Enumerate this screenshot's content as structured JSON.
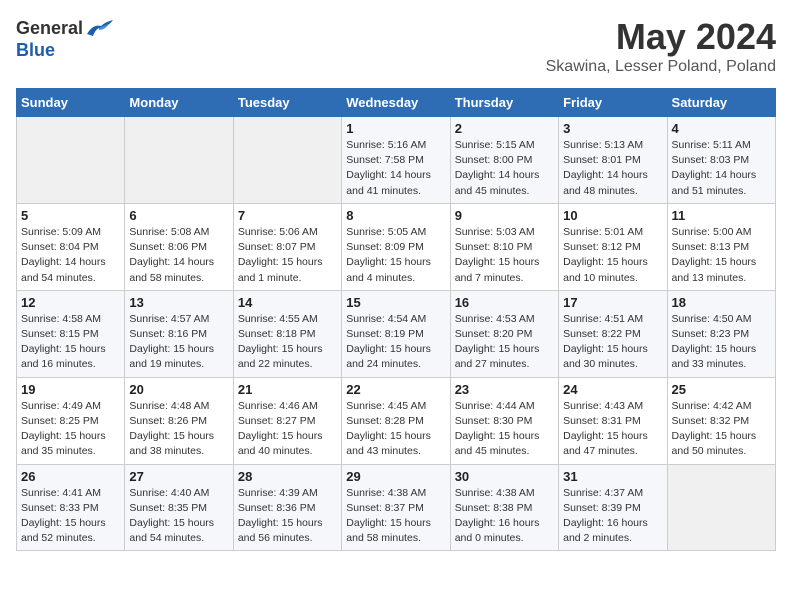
{
  "header": {
    "logo_general": "General",
    "logo_blue": "Blue",
    "month_title": "May 2024",
    "location": "Skawina, Lesser Poland, Poland"
  },
  "days_of_week": [
    "Sunday",
    "Monday",
    "Tuesday",
    "Wednesday",
    "Thursday",
    "Friday",
    "Saturday"
  ],
  "weeks": [
    [
      {
        "day": "",
        "info": ""
      },
      {
        "day": "",
        "info": ""
      },
      {
        "day": "",
        "info": ""
      },
      {
        "day": "1",
        "info": "Sunrise: 5:16 AM\nSunset: 7:58 PM\nDaylight: 14 hours\nand 41 minutes."
      },
      {
        "day": "2",
        "info": "Sunrise: 5:15 AM\nSunset: 8:00 PM\nDaylight: 14 hours\nand 45 minutes."
      },
      {
        "day": "3",
        "info": "Sunrise: 5:13 AM\nSunset: 8:01 PM\nDaylight: 14 hours\nand 48 minutes."
      },
      {
        "day": "4",
        "info": "Sunrise: 5:11 AM\nSunset: 8:03 PM\nDaylight: 14 hours\nand 51 minutes."
      }
    ],
    [
      {
        "day": "5",
        "info": "Sunrise: 5:09 AM\nSunset: 8:04 PM\nDaylight: 14 hours\nand 54 minutes."
      },
      {
        "day": "6",
        "info": "Sunrise: 5:08 AM\nSunset: 8:06 PM\nDaylight: 14 hours\nand 58 minutes."
      },
      {
        "day": "7",
        "info": "Sunrise: 5:06 AM\nSunset: 8:07 PM\nDaylight: 15 hours\nand 1 minute."
      },
      {
        "day": "8",
        "info": "Sunrise: 5:05 AM\nSunset: 8:09 PM\nDaylight: 15 hours\nand 4 minutes."
      },
      {
        "day": "9",
        "info": "Sunrise: 5:03 AM\nSunset: 8:10 PM\nDaylight: 15 hours\nand 7 minutes."
      },
      {
        "day": "10",
        "info": "Sunrise: 5:01 AM\nSunset: 8:12 PM\nDaylight: 15 hours\nand 10 minutes."
      },
      {
        "day": "11",
        "info": "Sunrise: 5:00 AM\nSunset: 8:13 PM\nDaylight: 15 hours\nand 13 minutes."
      }
    ],
    [
      {
        "day": "12",
        "info": "Sunrise: 4:58 AM\nSunset: 8:15 PM\nDaylight: 15 hours\nand 16 minutes."
      },
      {
        "day": "13",
        "info": "Sunrise: 4:57 AM\nSunset: 8:16 PM\nDaylight: 15 hours\nand 19 minutes."
      },
      {
        "day": "14",
        "info": "Sunrise: 4:55 AM\nSunset: 8:18 PM\nDaylight: 15 hours\nand 22 minutes."
      },
      {
        "day": "15",
        "info": "Sunrise: 4:54 AM\nSunset: 8:19 PM\nDaylight: 15 hours\nand 24 minutes."
      },
      {
        "day": "16",
        "info": "Sunrise: 4:53 AM\nSunset: 8:20 PM\nDaylight: 15 hours\nand 27 minutes."
      },
      {
        "day": "17",
        "info": "Sunrise: 4:51 AM\nSunset: 8:22 PM\nDaylight: 15 hours\nand 30 minutes."
      },
      {
        "day": "18",
        "info": "Sunrise: 4:50 AM\nSunset: 8:23 PM\nDaylight: 15 hours\nand 33 minutes."
      }
    ],
    [
      {
        "day": "19",
        "info": "Sunrise: 4:49 AM\nSunset: 8:25 PM\nDaylight: 15 hours\nand 35 minutes."
      },
      {
        "day": "20",
        "info": "Sunrise: 4:48 AM\nSunset: 8:26 PM\nDaylight: 15 hours\nand 38 minutes."
      },
      {
        "day": "21",
        "info": "Sunrise: 4:46 AM\nSunset: 8:27 PM\nDaylight: 15 hours\nand 40 minutes."
      },
      {
        "day": "22",
        "info": "Sunrise: 4:45 AM\nSunset: 8:28 PM\nDaylight: 15 hours\nand 43 minutes."
      },
      {
        "day": "23",
        "info": "Sunrise: 4:44 AM\nSunset: 8:30 PM\nDaylight: 15 hours\nand 45 minutes."
      },
      {
        "day": "24",
        "info": "Sunrise: 4:43 AM\nSunset: 8:31 PM\nDaylight: 15 hours\nand 47 minutes."
      },
      {
        "day": "25",
        "info": "Sunrise: 4:42 AM\nSunset: 8:32 PM\nDaylight: 15 hours\nand 50 minutes."
      }
    ],
    [
      {
        "day": "26",
        "info": "Sunrise: 4:41 AM\nSunset: 8:33 PM\nDaylight: 15 hours\nand 52 minutes."
      },
      {
        "day": "27",
        "info": "Sunrise: 4:40 AM\nSunset: 8:35 PM\nDaylight: 15 hours\nand 54 minutes."
      },
      {
        "day": "28",
        "info": "Sunrise: 4:39 AM\nSunset: 8:36 PM\nDaylight: 15 hours\nand 56 minutes."
      },
      {
        "day": "29",
        "info": "Sunrise: 4:38 AM\nSunset: 8:37 PM\nDaylight: 15 hours\nand 58 minutes."
      },
      {
        "day": "30",
        "info": "Sunrise: 4:38 AM\nSunset: 8:38 PM\nDaylight: 16 hours\nand 0 minutes."
      },
      {
        "day": "31",
        "info": "Sunrise: 4:37 AM\nSunset: 8:39 PM\nDaylight: 16 hours\nand 2 minutes."
      },
      {
        "day": "",
        "info": ""
      }
    ]
  ]
}
